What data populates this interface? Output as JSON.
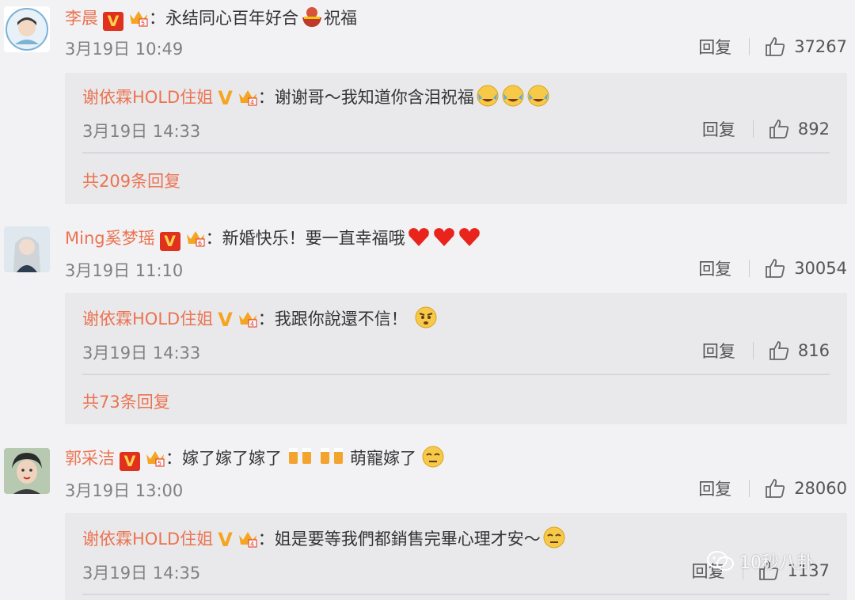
{
  "comments": [
    {
      "username": "李晨",
      "text": "：永结同心百年好合",
      "text2": "祝福",
      "date": "3月19日 10:49",
      "reply_label": "回复",
      "likes": "37267",
      "reply": {
        "username": "谢依霖HOLD住姐",
        "text": "：谢谢哥～我知道你含泪祝福",
        "date": "3月19日 14:33",
        "reply_label": "回复",
        "likes": "892"
      },
      "more_replies": "共209条回复"
    },
    {
      "username": "Ming奚梦瑶",
      "text": "：新婚快乐！要一直幸福哦",
      "date": "3月19日 11:10",
      "reply_label": "回复",
      "likes": "30054",
      "reply": {
        "username": "谢依霖HOLD住姐",
        "text": "：我跟你說還不信！",
        "date": "3月19日 14:33",
        "reply_label": "回复",
        "likes": "816"
      },
      "more_replies": "共73条回复"
    },
    {
      "username": "郭采洁",
      "text": "：嫁了嫁了嫁了",
      "text2": "萌寵嫁了",
      "date": "3月19日 13:00",
      "reply_label": "回复",
      "likes": "28060",
      "reply": {
        "username": "谢依霖HOLD住姐",
        "text": "：姐是要等我們都銷售完畢心理才安～",
        "date": "3月19日 14:35",
        "reply_label": "回复",
        "likes": "1137"
      }
    }
  ],
  "watermark": "10秒八卦",
  "colors": {
    "username": "#eb7350",
    "background": "#f2f2f5",
    "reply_bg": "#e9e9ec"
  }
}
